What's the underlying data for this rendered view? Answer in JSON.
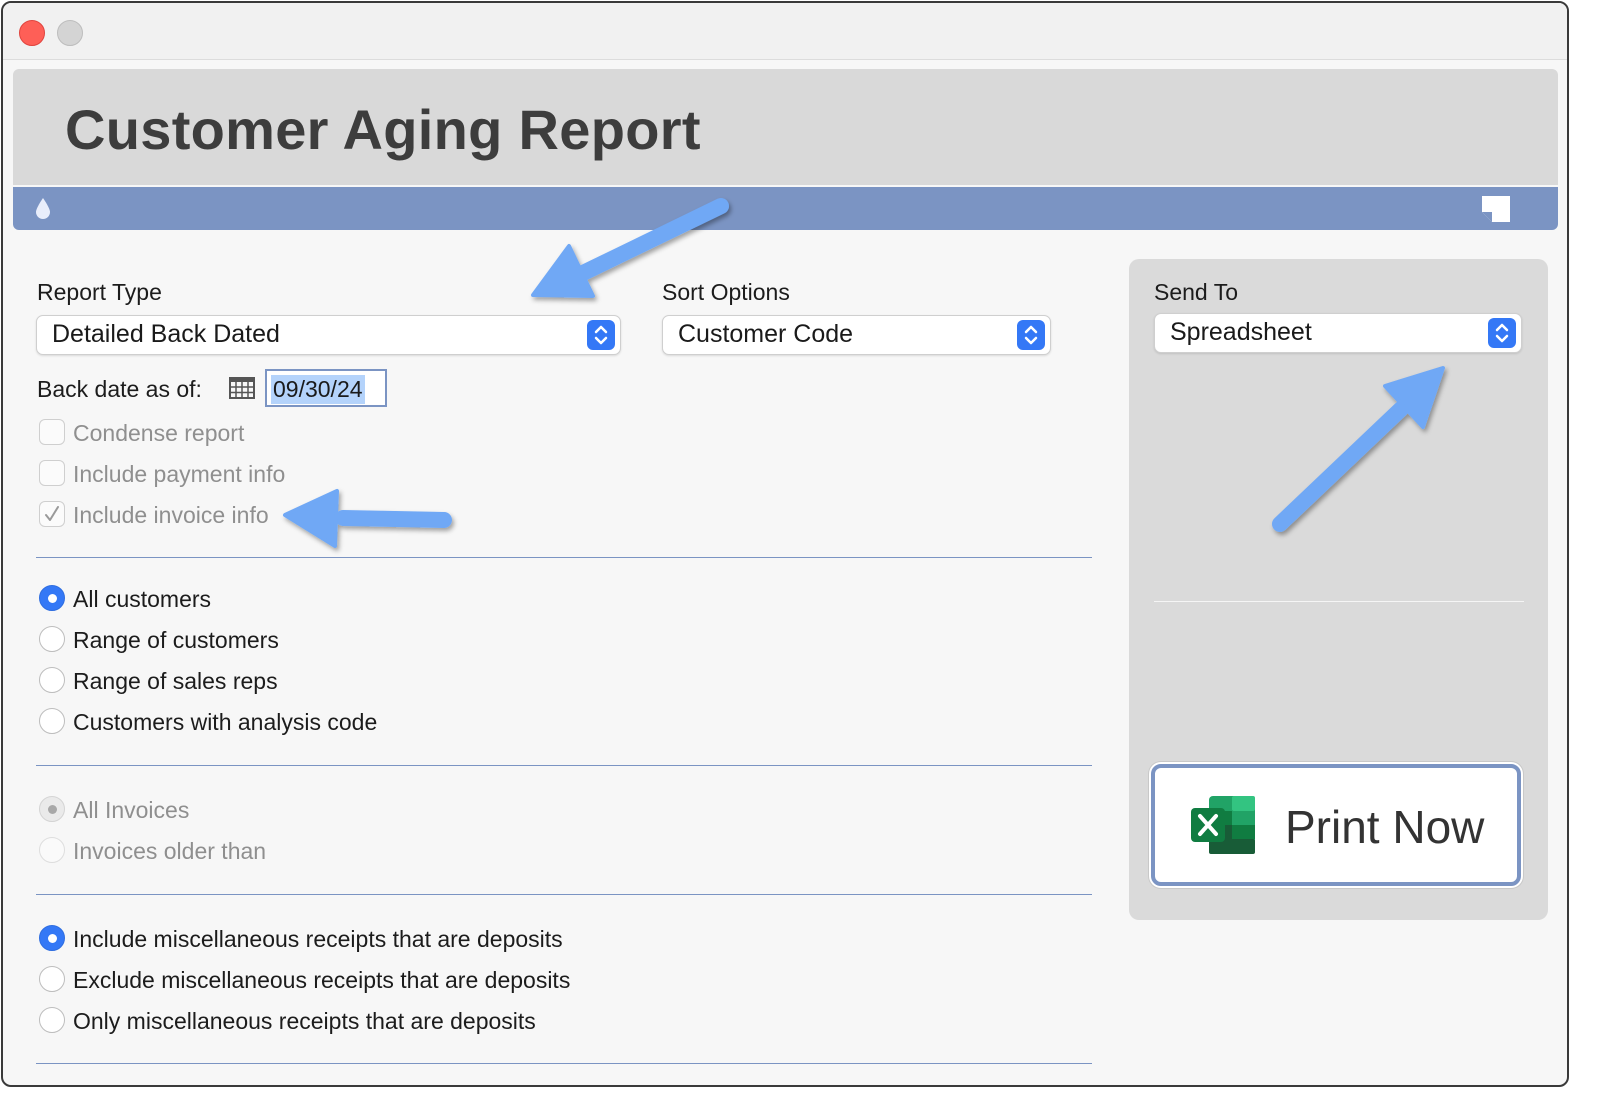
{
  "window": {
    "title": "Customer Aging Report"
  },
  "report_type": {
    "label": "Report Type",
    "value": "Detailed Back Dated"
  },
  "sort_options": {
    "label": "Sort Options",
    "value": "Customer Code"
  },
  "back_date": {
    "label": "Back date as of:",
    "value": "09/30/24"
  },
  "checkboxes": [
    {
      "label": "Condense report",
      "checked": false,
      "disabled": true
    },
    {
      "label": "Include payment info",
      "checked": false,
      "disabled": true
    },
    {
      "label": "Include invoice info",
      "checked": true,
      "disabled": true
    }
  ],
  "customer_group": [
    {
      "label": "All customers",
      "selected": true
    },
    {
      "label": "Range of customers",
      "selected": false
    },
    {
      "label": "Range of sales reps",
      "selected": false
    },
    {
      "label": "Customers with analysis code",
      "selected": false
    }
  ],
  "invoice_group": [
    {
      "label": "All Invoices",
      "selected": true,
      "disabled": true
    },
    {
      "label": "Invoices older than",
      "selected": false,
      "disabled": true
    }
  ],
  "receipts_group": [
    {
      "label": "Include miscellaneous receipts that are deposits",
      "selected": true
    },
    {
      "label": "Exclude miscellaneous receipts that are deposits",
      "selected": false
    },
    {
      "label": "Only miscellaneous receipts that are deposits",
      "selected": false
    }
  ],
  "send_to": {
    "label": "Send To",
    "value": "Spreadsheet"
  },
  "print_button": {
    "label": "Print Now",
    "icon": "excel-icon"
  },
  "colors": {
    "accent": "#7b94c3",
    "selection_blue": "#3478f6",
    "arrow": "#6fa8f5"
  }
}
